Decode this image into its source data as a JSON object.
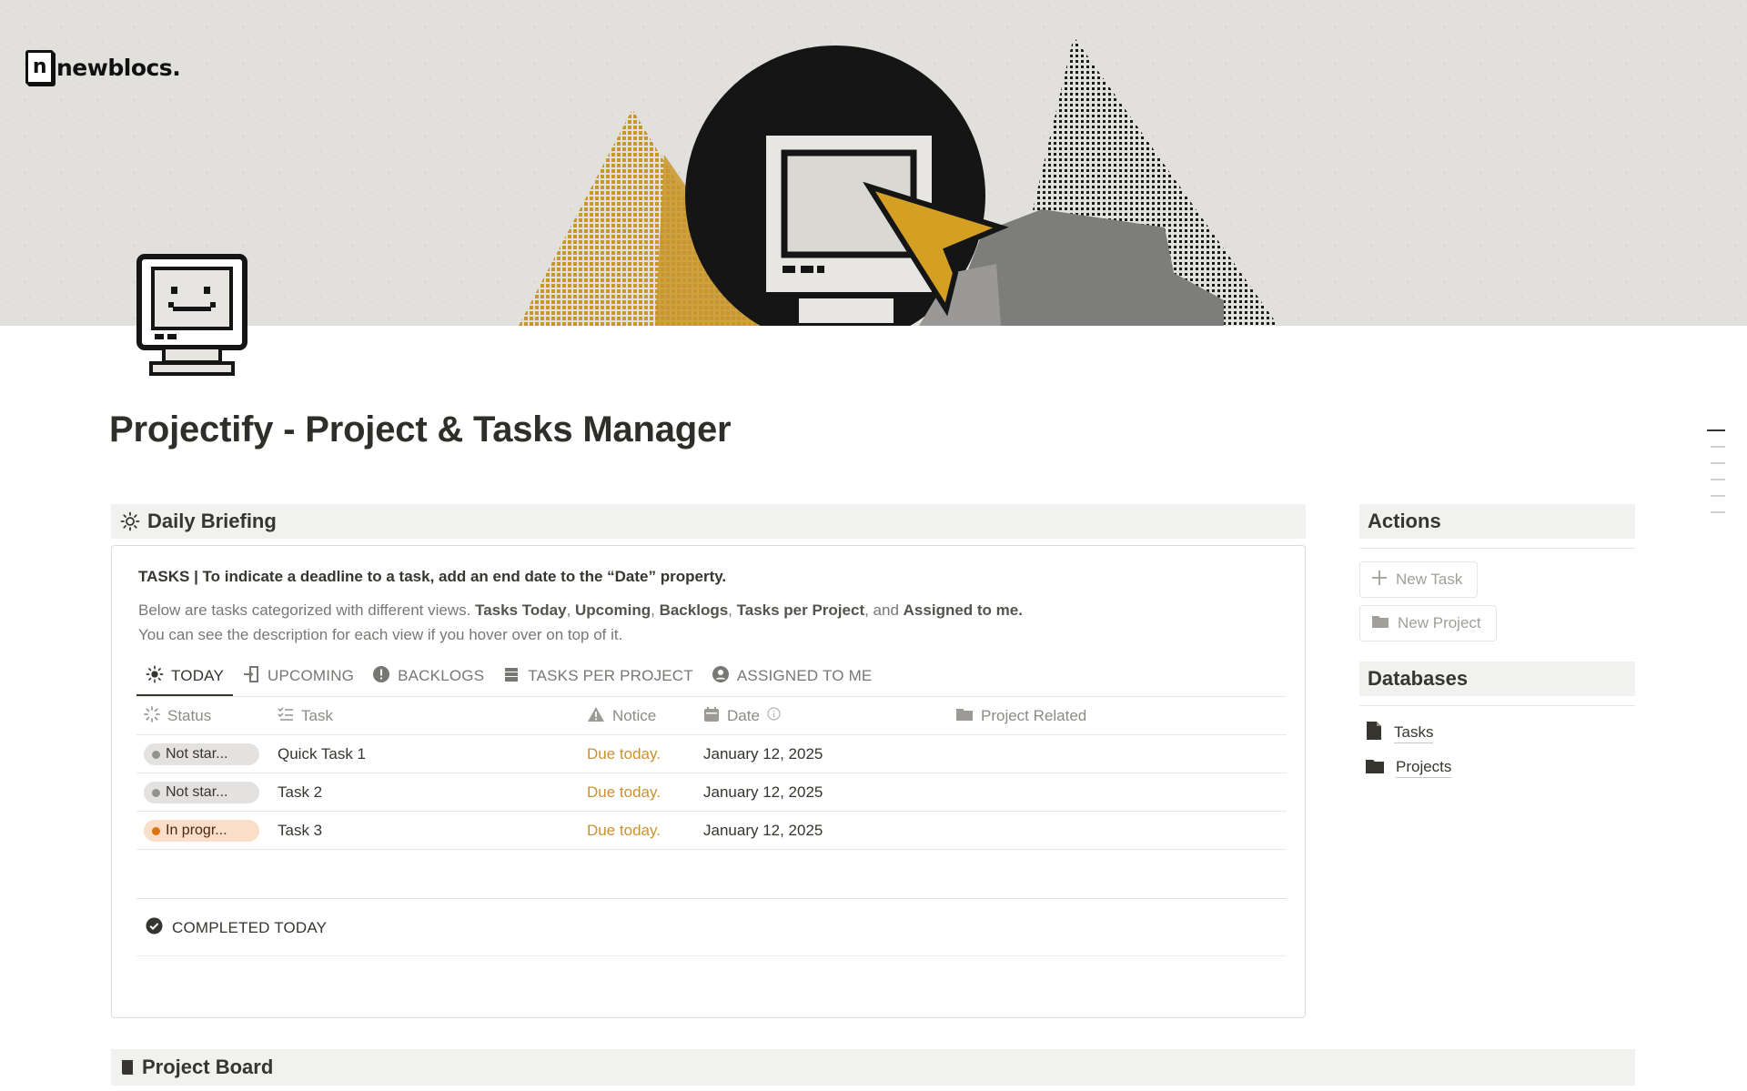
{
  "brand": {
    "name": "newblocs.",
    "mark": "n"
  },
  "page": {
    "title": "Projectify - Project & Tasks Manager"
  },
  "daily_briefing": {
    "header": "Daily Briefing",
    "heading": "TASKS | To indicate a deadline to a task, add an end date to the “Date” property.",
    "desc_prefix": "Below are tasks categorized with different views. ",
    "views": [
      "Tasks Today",
      "Upcoming",
      "Backlogs",
      "Tasks per Project",
      "Assigned to me."
    ],
    "desc_seps": [
      ", ",
      ", ",
      ", ",
      ", and "
    ],
    "desc_line2": "You can see the description for each view if you hover over on top of it.",
    "tabs": [
      {
        "label": "TODAY",
        "icon": "sun-icon",
        "active": true
      },
      {
        "label": "UPCOMING",
        "icon": "door-arrow-icon",
        "active": false
      },
      {
        "label": "BACKLOGS",
        "icon": "exclamation-circle-icon",
        "active": false
      },
      {
        "label": "TASKS PER PROJECT",
        "icon": "stack-icon",
        "active": false
      },
      {
        "label": "ASSIGNED TO ME",
        "icon": "user-circle-icon",
        "active": false
      }
    ],
    "columns": {
      "status": "Status",
      "task": "Task",
      "notice": "Notice",
      "date": "Date",
      "project": "Project Related"
    },
    "rows": [
      {
        "status": "Not star...",
        "status_color": "gray",
        "task": "Quick Task 1",
        "notice": "Due today.",
        "date": "January 12, 2025",
        "project": ""
      },
      {
        "status": "Not star...",
        "status_color": "gray",
        "task": "Task 2",
        "notice": "Due today.",
        "date": "January 12, 2025",
        "project": ""
      },
      {
        "status": "In progr...",
        "status_color": "orange",
        "task": "Task 3",
        "notice": "Due today.",
        "date": "January 12, 2025",
        "project": ""
      }
    ],
    "completed_label": "COMPLETED TODAY"
  },
  "actions": {
    "header": "Actions",
    "buttons": [
      {
        "label": "New Task",
        "icon": "plus-icon"
      },
      {
        "label": "New Project",
        "icon": "folder-icon"
      }
    ]
  },
  "databases": {
    "header": "Databases",
    "items": [
      {
        "label": "Tasks",
        "icon": "document-icon"
      },
      {
        "label": "Projects",
        "icon": "folder-icon"
      }
    ]
  },
  "project_board": {
    "header": "Project Board"
  },
  "colors": {
    "accent_gold": "#d4a024",
    "due_text": "#cb912f",
    "header_bg": "#f1f1ef",
    "text": "#37352f"
  }
}
